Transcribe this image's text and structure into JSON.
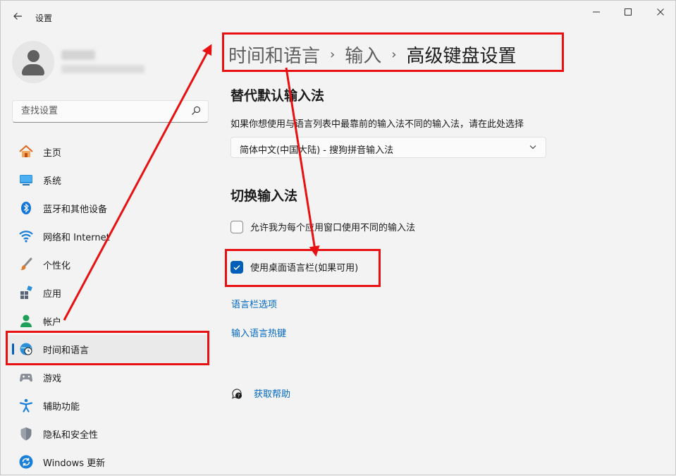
{
  "window": {
    "title": "设置",
    "back_icon": "back-arrow-icon",
    "controls": {
      "minimize": "—",
      "maximize": "☐",
      "close": "✕"
    }
  },
  "user": {
    "name_blurred": true,
    "email_blurred": true
  },
  "search": {
    "placeholder": "查找设置",
    "value": ""
  },
  "sidebar": {
    "items": [
      {
        "label": "主页",
        "icon": "home-icon"
      },
      {
        "label": "系统",
        "icon": "system-display-icon"
      },
      {
        "label": "蓝牙和其他设备",
        "icon": "bluetooth-icon"
      },
      {
        "label": "网络和 Internet",
        "icon": "wifi-icon"
      },
      {
        "label": "个性化",
        "icon": "paintbrush-icon"
      },
      {
        "label": "应用",
        "icon": "apps-icon"
      },
      {
        "label": "帐户",
        "icon": "account-icon"
      },
      {
        "label": "时间和语言",
        "icon": "time-language-icon",
        "active": true
      },
      {
        "label": "游戏",
        "icon": "gamepad-icon"
      },
      {
        "label": "辅助功能",
        "icon": "accessibility-icon"
      },
      {
        "label": "隐私和安全性",
        "icon": "shield-icon"
      },
      {
        "label": "Windows 更新",
        "icon": "windows-update-icon"
      }
    ]
  },
  "breadcrumb": {
    "items": [
      "时间和语言",
      "输入",
      "高级键盘设置"
    ],
    "separator": "›"
  },
  "main": {
    "override_section": {
      "title": "替代默认输入法",
      "description": "如果你想使用与语言列表中最靠前的输入法不同的输入法，请在此处选择",
      "dropdown_value": "简体中文(中国大陆) - 搜狗拼音输入法"
    },
    "switch_section": {
      "title": "切换输入法",
      "checkbox_per_app": {
        "label": "允许我为每个应用窗口使用不同的输入法",
        "checked": false
      },
      "checkbox_language_bar": {
        "label": "使用桌面语言栏(如果可用)",
        "checked": true
      },
      "link_language_bar_options": "语言栏选项",
      "link_hotkeys": "输入语言热键"
    },
    "help": {
      "label": "获取帮助",
      "icon": "help-icon"
    }
  },
  "annotation_color": "#e81010",
  "accent_color": "#005fb8",
  "link_color": "#0067c0"
}
